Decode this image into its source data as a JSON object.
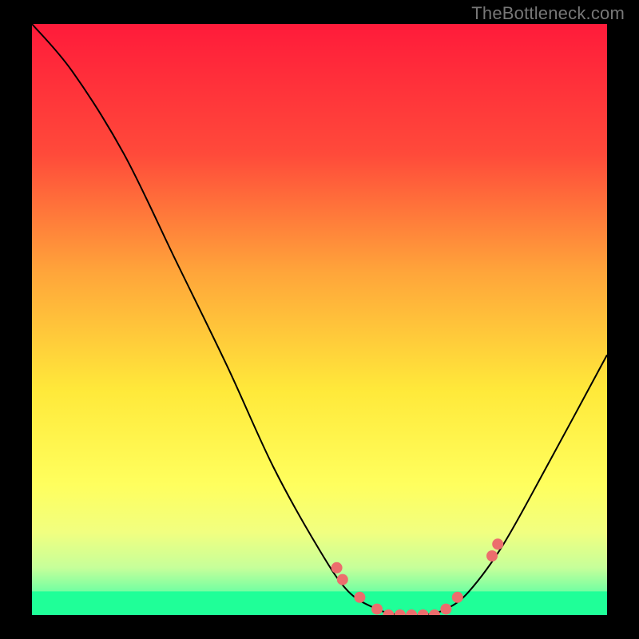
{
  "attribution": "TheBottleneck.com",
  "chart_data": {
    "type": "line",
    "title": "",
    "xlabel": "",
    "ylabel": "",
    "xlim": [
      0,
      100
    ],
    "ylim": [
      0,
      100
    ],
    "grid": false,
    "legend": false,
    "gradient_stops": [
      {
        "offset": 0,
        "color": "#ff1b3a"
      },
      {
        "offset": 0.22,
        "color": "#ff4a3a"
      },
      {
        "offset": 0.42,
        "color": "#ffa53a"
      },
      {
        "offset": 0.62,
        "color": "#ffe93a"
      },
      {
        "offset": 0.78,
        "color": "#ffff5e"
      },
      {
        "offset": 0.86,
        "color": "#f1ff80"
      },
      {
        "offset": 0.92,
        "color": "#c6ff9a"
      },
      {
        "offset": 0.97,
        "color": "#5effa4"
      },
      {
        "offset": 1.0,
        "color": "#1fff98"
      }
    ],
    "green_band_y": [
      0,
      4
    ],
    "series": [
      {
        "name": "bottleneck-curve",
        "color": "#000000",
        "points": [
          {
            "x": 0,
            "y": 100
          },
          {
            "x": 7,
            "y": 92
          },
          {
            "x": 16,
            "y": 78
          },
          {
            "x": 25,
            "y": 60
          },
          {
            "x": 34,
            "y": 42
          },
          {
            "x": 42,
            "y": 25
          },
          {
            "x": 50,
            "y": 11
          },
          {
            "x": 55,
            "y": 4
          },
          {
            "x": 60,
            "y": 1
          },
          {
            "x": 64,
            "y": 0
          },
          {
            "x": 68,
            "y": 0
          },
          {
            "x": 72,
            "y": 1
          },
          {
            "x": 76,
            "y": 4
          },
          {
            "x": 82,
            "y": 12
          },
          {
            "x": 90,
            "y": 26
          },
          {
            "x": 100,
            "y": 44
          }
        ]
      }
    ],
    "markers": {
      "color": "#ec6d6d",
      "radius": 7,
      "points": [
        {
          "x": 53,
          "y": 8
        },
        {
          "x": 54,
          "y": 6
        },
        {
          "x": 57,
          "y": 3
        },
        {
          "x": 60,
          "y": 1
        },
        {
          "x": 62,
          "y": 0
        },
        {
          "x": 64,
          "y": 0
        },
        {
          "x": 66,
          "y": 0
        },
        {
          "x": 68,
          "y": 0
        },
        {
          "x": 70,
          "y": 0
        },
        {
          "x": 72,
          "y": 1
        },
        {
          "x": 74,
          "y": 3
        },
        {
          "x": 80,
          "y": 10
        },
        {
          "x": 81,
          "y": 12
        }
      ]
    }
  }
}
